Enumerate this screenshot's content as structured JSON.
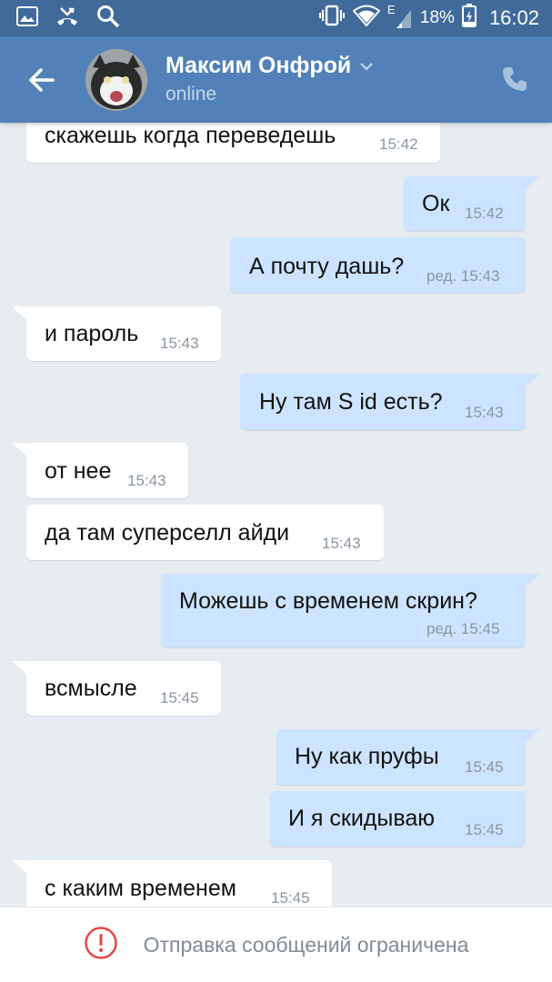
{
  "status_bar": {
    "time": "16:02",
    "battery_percent": "18%",
    "network_label": "E"
  },
  "header": {
    "contact_name": "Максим Онфрой",
    "contact_status": "online"
  },
  "messages": [
    {
      "dir": "in",
      "text": "скажешь когда переведешь",
      "time": "15:42"
    },
    {
      "dir": "out",
      "text": "Ок",
      "time": "15:42"
    },
    {
      "dir": "out",
      "text": "А почту дашь?",
      "time": "ред. 15:43"
    },
    {
      "dir": "in",
      "text": "и пароль",
      "time": "15:43"
    },
    {
      "dir": "out",
      "text": "Ну там S id есть?",
      "time": "15:43"
    },
    {
      "dir": "in",
      "text": "от нее",
      "time": "15:43"
    },
    {
      "dir": "in",
      "text": "да там суперселл айди",
      "time": "15:43"
    },
    {
      "dir": "out",
      "text": "Можешь с временем скрин?",
      "time": "ред. 15:45"
    },
    {
      "dir": "in",
      "text": "всмысле",
      "time": "15:45"
    },
    {
      "dir": "out",
      "text": "Ну как пруфы",
      "time": "15:45"
    },
    {
      "dir": "out",
      "text": "И я скидываю",
      "time": "15:45"
    },
    {
      "dir": "in",
      "text": "с каким временем",
      "time": "15:45"
    }
  ],
  "footer": {
    "notice": "Отправка сообщений ограничена"
  },
  "colors": {
    "header": "#5181b8",
    "status_bar": "#3f6a9a",
    "background": "#e7ecf1",
    "incoming_bubble": "#ffffff",
    "outgoing_bubble": "#cce4ff",
    "warning": "#e64646"
  }
}
